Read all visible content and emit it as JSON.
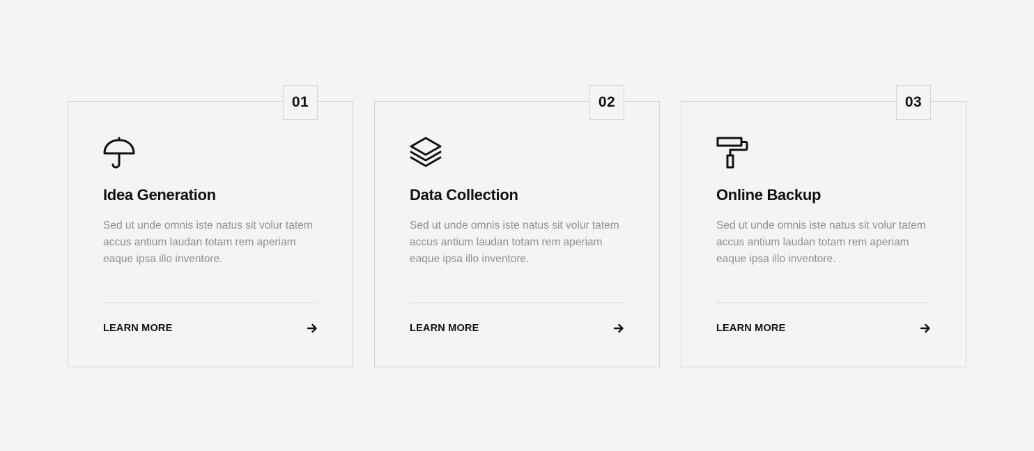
{
  "cards": [
    {
      "number": "01",
      "icon": "umbrella-icon",
      "title": "Idea Generation",
      "description": "Sed ut unde omnis iste natus sit volur tatem accus antium laudan totam rem aperiam eaque ipsa illo inventore.",
      "link_label": "LEARN MORE"
    },
    {
      "number": "02",
      "icon": "layers-icon",
      "title": "Data Collection",
      "description": "Sed ut unde omnis iste natus sit volur tatem accus antium laudan totam rem aperiam eaque ipsa illo inventore.",
      "link_label": "LEARN MORE"
    },
    {
      "number": "03",
      "icon": "paint-roller-icon",
      "title": "Online Backup",
      "description": "Sed ut unde omnis iste natus sit volur tatem accus antium laudan totam rem aperiam eaque ipsa illo inventore.",
      "link_label": "LEARN MORE"
    }
  ],
  "colors": {
    "background": "#f4f4f4",
    "border": "#d6d6d6",
    "heading": "#111111",
    "body_text": "#8f8f8f"
  }
}
